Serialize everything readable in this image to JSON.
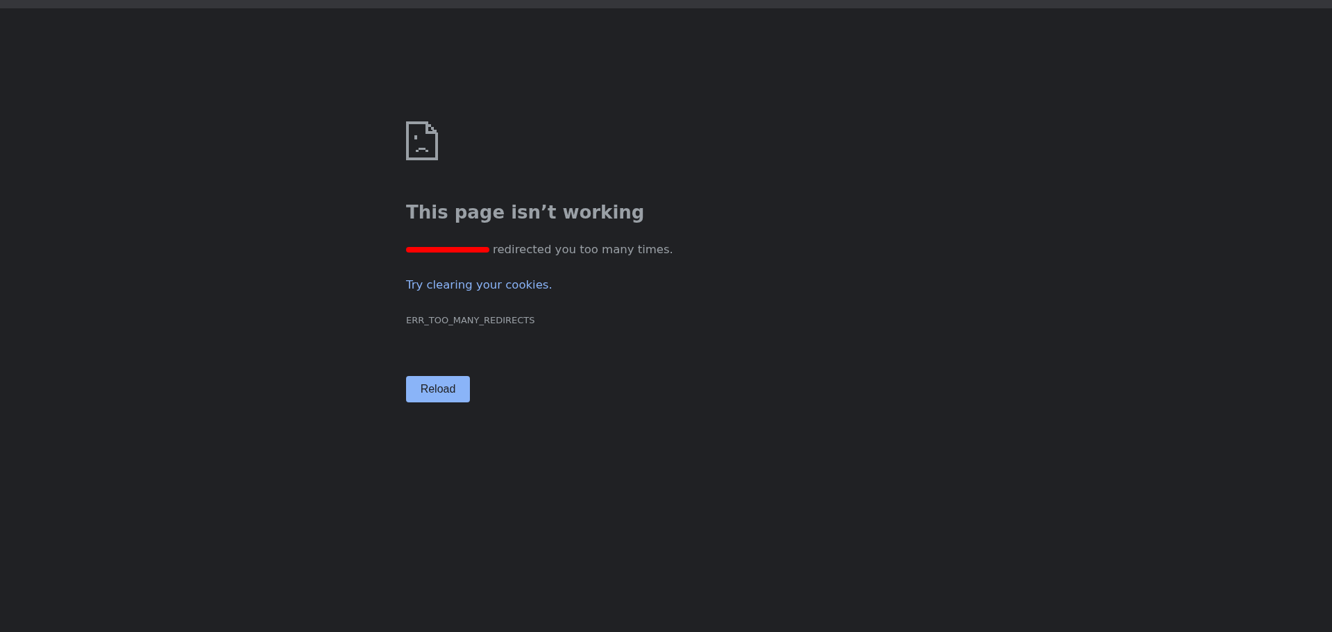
{
  "heading": "This page isn’t working",
  "message": {
    "redacted_domain": true,
    "text": "redirected you too many times."
  },
  "suggestion": {
    "link": "Try clearing your cookies",
    "after": "."
  },
  "error_code": "ERR_TOO_MANY_REDIRECTS",
  "buttons": [
    "Reload"
  ]
}
